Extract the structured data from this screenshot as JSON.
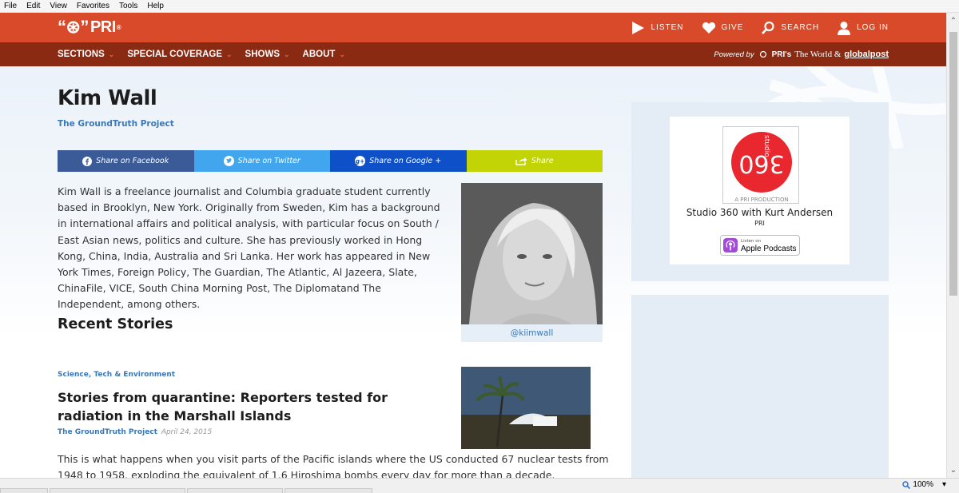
{
  "menubar": {
    "items": [
      "File",
      "Edit",
      "View",
      "Favorites",
      "Tools",
      "Help"
    ]
  },
  "brand": {
    "logo_text": "PRI",
    "colors": {
      "red": "#d94a2a",
      "dark_red": "#8a2a12",
      "link_blue": "#3b78b8"
    }
  },
  "topnav": {
    "listen": "LISTEN",
    "give": "GIVE",
    "search": "SEARCH",
    "login": "LOG IN"
  },
  "subnav": {
    "sections": [
      "SECTIONS",
      "SPECIAL COVERAGE",
      "SHOWS",
      "ABOUT"
    ],
    "powered_by": "Powered by",
    "powered_pri": "PRI's",
    "powered_world": "The World &",
    "powered_gp": "globalpost"
  },
  "profile": {
    "name": "Kim Wall",
    "affiliation": "The GroundTruth Project",
    "bio": "Kim Wall is a freelance journalist and Columbia graduate student currently based in Brooklyn, New York. Originally from Sweden, Kim has a background in international affairs and political analysis, with particular focus on South / East Asian news, politics and culture. She has previously worked in Hong Kong, China, India, Australia and Sri Lanka. Her work has appeared in  New York Times, Foreign Policy, The Guardian, The Atlantic, Al Jazeera, Slate, ChinaFile, VICE, South China Morning Post, The Diplomatand The Independent, among others.",
    "handle": "@kiimwall"
  },
  "share": {
    "facebook": "Share on Facebook",
    "twitter": "Share on Twitter",
    "google": "Share on Google +",
    "generic": "Share"
  },
  "recent": {
    "heading": "Recent Stories",
    "story": {
      "category": "Science, Tech & Environment",
      "title": "Stories from quarantine: Reporters tested for radiation in the Marshall Islands",
      "source": "The GroundTruth Project",
      "date": "April 24, 2015",
      "excerpt": "This is what happens when you visit parts of the Pacific islands where the US conducted 67 nuclear tests from 1948 to 1958, exploding the equivalent of 1.6 Hiroshima bombs every day for more than a decade."
    }
  },
  "sidebar": {
    "logo_word": "studio",
    "logo_num": "360",
    "production": "A PRI PRODUCTION",
    "show_name": "Studio 360 with Kurt Andersen",
    "network": "PRI",
    "podcast_small": "Listen on",
    "podcast_big": "Apple Podcasts"
  },
  "statusbar": {
    "zoom": "100%"
  }
}
